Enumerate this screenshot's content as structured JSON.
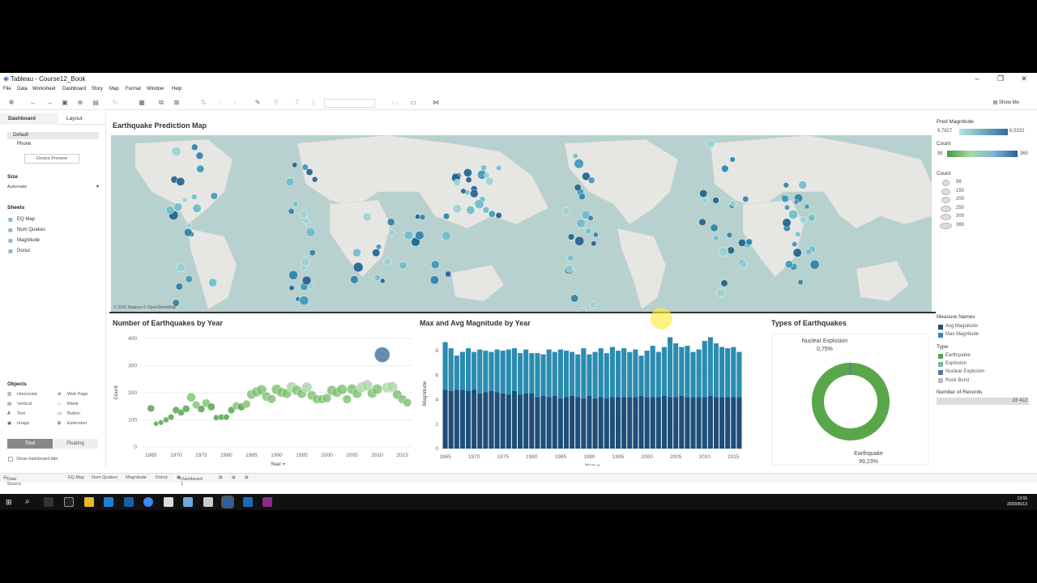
{
  "window": {
    "title": "Tableau - Course12_Book"
  },
  "menu": [
    "File",
    "Data",
    "Worksheet",
    "Dashboard",
    "Story",
    "Map",
    "Format",
    "Window",
    "Help"
  ],
  "toolbar": {
    "show_me": "Show Me"
  },
  "sidebar": {
    "tabs": [
      "Dashboard",
      "Layout"
    ],
    "device": [
      "Default",
      "Phone"
    ],
    "device_preview": "Device Preview",
    "size_label": "Size",
    "size_value": "Automatic",
    "sheets_label": "Sheets",
    "sheets": [
      "EQ Map",
      "Num Quakes",
      "Magnitude",
      "Donut"
    ],
    "objects_label": "Objects",
    "objects": [
      "Horizontal",
      "Web Page",
      "Vertical",
      "Blank",
      "Text",
      "Button",
      "Image",
      "Extension"
    ],
    "tiled": "Tiled",
    "floating": "Floating",
    "show_title": "Show dashboard title"
  },
  "map": {
    "title": "Earthquake Prediction Map",
    "attribution": "© 2020 Mapbox © OpenStreetMap"
  },
  "chart_data": [
    {
      "type": "scatter",
      "title": "Number of Earthquakes by Year",
      "xlabel": "Year",
      "ylabel": "Count",
      "ylim": [
        0,
        400
      ],
      "yticks": [
        "400",
        "300",
        "200",
        "100",
        "0"
      ],
      "xticks": [
        "1965",
        "1970",
        "1975",
        "1980",
        "1985",
        "1990",
        "1995",
        "2000",
        "2005",
        "2010",
        "2015"
      ],
      "x": [
        1965,
        1966,
        1967,
        1968,
        1969,
        1970,
        1971,
        1972,
        1973,
        1974,
        1975,
        1976,
        1977,
        1978,
        1979,
        1980,
        1981,
        1982,
        1983,
        1984,
        1985,
        1986,
        1987,
        1988,
        1989,
        1990,
        1991,
        1992,
        1993,
        1994,
        1995,
        1996,
        1997,
        1998,
        1999,
        2000,
        2001,
        2002,
        2003,
        2004,
        2005,
        2006,
        2007,
        2008,
        2009,
        2010,
        2011,
        2012,
        2013,
        2014,
        2015,
        2016
      ],
      "y": [
        142,
        86,
        90,
        100,
        110,
        136,
        127,
        141,
        183,
        155,
        140,
        162,
        148,
        108,
        110,
        110,
        136,
        152,
        148,
        158,
        194,
        203,
        210,
        186,
        177,
        212,
        201,
        197,
        221,
        209,
        197,
        220,
        190,
        176,
        176,
        180,
        208,
        201,
        212,
        176,
        213,
        197,
        221,
        227,
        198,
        213,
        340,
        219,
        222,
        193,
        176,
        163
      ]
    },
    {
      "type": "bar",
      "title": "Max and Avg Magnitude by Year",
      "xlabel": "Year",
      "ylabel": "Magnitude",
      "ylim": [
        0,
        9
      ],
      "yticks": [
        "8",
        "6",
        "4",
        "2",
        "0"
      ],
      "xticks": [
        "1965",
        "1970",
        "1975",
        "1980",
        "1985",
        "1990",
        "1995",
        "2000",
        "2005",
        "2010",
        "2015"
      ],
      "categories": [
        1965,
        1966,
        1967,
        1968,
        1969,
        1970,
        1971,
        1972,
        1973,
        1974,
        1975,
        1976,
        1977,
        1978,
        1979,
        1980,
        1981,
        1982,
        1983,
        1984,
        1985,
        1986,
        1987,
        1988,
        1989,
        1990,
        1991,
        1992,
        1993,
        1994,
        1995,
        1996,
        1997,
        1998,
        1999,
        2000,
        2001,
        2002,
        2003,
        2004,
        2005,
        2006,
        2007,
        2008,
        2009,
        2010,
        2011,
        2012,
        2013,
        2014,
        2015,
        2016
      ],
      "series": [
        {
          "name": "Avg Magnitude",
          "values": [
            4.8,
            4.7,
            4.8,
            4.8,
            4.7,
            4.8,
            4.5,
            4.6,
            4.7,
            4.6,
            4.5,
            4.4,
            4.7,
            4.4,
            4.5,
            4.5,
            4.2,
            4.3,
            4.2,
            4.3,
            4.1,
            4.2,
            4.3,
            4.2,
            4.1,
            4.3,
            4.1,
            4.2,
            4.1,
            4.2,
            4.2,
            4.2,
            4.2,
            4.2,
            4.3,
            4.2,
            4.2,
            4.2,
            4.3,
            4.2,
            4.2,
            4.3,
            4.2,
            4.2,
            4.2,
            4.2,
            4.3,
            4.2,
            4.2,
            4.2,
            4.2,
            4.2
          ]
        },
        {
          "name": "Max Magnitude",
          "values": [
            8.7,
            8.2,
            7.6,
            7.9,
            8.2,
            7.9,
            8.1,
            8.0,
            7.9,
            8.1,
            8.0,
            8.1,
            8.2,
            7.8,
            8.1,
            7.8,
            7.8,
            7.7,
            8.1,
            7.9,
            8.1,
            8.0,
            7.9,
            7.7,
            8.2,
            7.7,
            7.9,
            8.2,
            7.8,
            8.3,
            8.0,
            8.2,
            7.9,
            8.1,
            7.6,
            8.0,
            8.4,
            7.9,
            8.3,
            9.1,
            8.6,
            8.3,
            8.4,
            7.9,
            8.1,
            8.8,
            9.1,
            8.6,
            8.3,
            8.2,
            8.3,
            7.9
          ]
        }
      ]
    },
    {
      "type": "pie",
      "title": "Types of Earthquakes",
      "categories": [
        "Earthquake",
        "Nuclear Explosion"
      ],
      "labels": [
        "Earthquake",
        "Nuclear Explosion"
      ],
      "value_labels": [
        "99,23%",
        "0,75%"
      ],
      "values": [
        99.23,
        0.75
      ]
    }
  ],
  "legends": {
    "pred_magnitude": {
      "title": "Pred Magnitude",
      "min": "5,7827",
      "max": "6,0332"
    },
    "count_color": {
      "title": "Count",
      "min": "98",
      "max": "360"
    },
    "count_size": {
      "title": "Count",
      "items": [
        "98",
        "150",
        "200",
        "250",
        "300",
        "360"
      ]
    },
    "measure_names": {
      "title": "Measure Names",
      "items": [
        "Avg Magnitude",
        "Max Magnitude"
      ],
      "colors": [
        "#1f4e79",
        "#2b8cb0"
      ]
    },
    "type": {
      "title": "Type",
      "items": [
        "Earthquake",
        "Explosion",
        "Nuclear Explosion",
        "Rock Burst"
      ],
      "colors": [
        "#59a14f",
        "#76b7a0",
        "#4e79a7",
        "#b9b9b9"
      ]
    },
    "records": {
      "title": "Number of Records",
      "value": "23 412"
    }
  },
  "sheet_tabs": [
    "Data Source",
    "EQ Map",
    "Num Quakes",
    "Magnitude",
    "Donut",
    "Dashboard 1"
  ],
  "clock": {
    "time": "13:55",
    "date": "2020/06/13"
  }
}
